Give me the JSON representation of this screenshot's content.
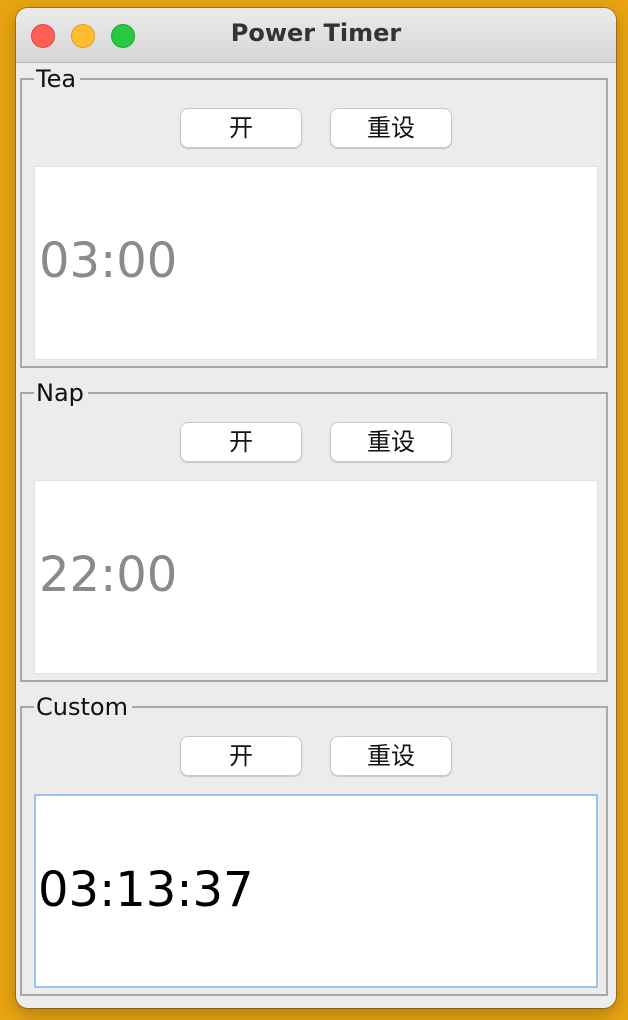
{
  "window": {
    "title": "Power Timer"
  },
  "timers": [
    {
      "label": "Tea",
      "start_label": "开",
      "reset_label": "重设",
      "display": "03:00"
    },
    {
      "label": "Nap",
      "start_label": "开",
      "reset_label": "重设",
      "display": "22:00"
    },
    {
      "label": "Custom",
      "start_label": "开",
      "reset_label": "重设",
      "display": "03:13:37"
    }
  ],
  "colors": {
    "desktop": "#E8A412",
    "window_bg": "#ECECEC",
    "inactive_text": "#8A8A8A",
    "active_text": "#000000",
    "focus_ring": "#9CC3EC"
  }
}
